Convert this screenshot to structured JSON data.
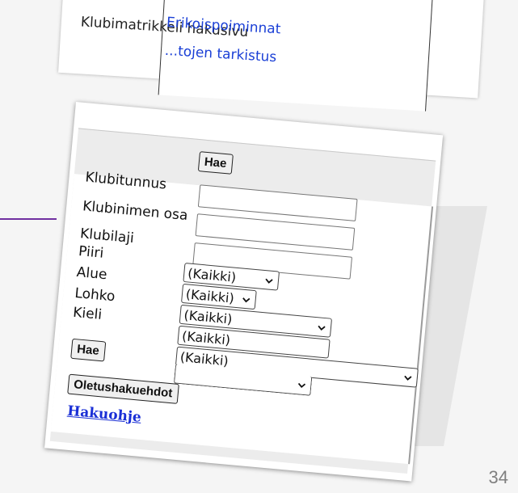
{
  "slide": {
    "number": "34"
  },
  "top_menu": {
    "partial_text": "Klubimatrikkeli hakusivu",
    "items": [
      "Erikoispoiminnat",
      "...tojen tarkistus"
    ]
  },
  "form": {
    "top_button": "Hae",
    "fields": [
      {
        "label": "Klubitunnus",
        "type": "text",
        "value": ""
      },
      {
        "label": "Klubinimen osa",
        "type": "text",
        "value": ""
      },
      {
        "label": "Klubilaji",
        "type": "select",
        "value": "(Kaikki)"
      },
      {
        "label": "Piiri",
        "type": "select",
        "value": "(Kaikki)"
      },
      {
        "label": "Alue",
        "type": "select",
        "value": "(Kaikki)"
      },
      {
        "label": "Lohko",
        "type": "select",
        "value": "(Kaikki)"
      },
      {
        "label": "Kieli",
        "type": "select",
        "value": "(Kaikki)"
      }
    ],
    "bottom_button": "Hae",
    "defaults_button": "Oletushakuehdot",
    "help_link": "Hakuohje"
  },
  "colors": {
    "accent": "#7030a0",
    "link": "#1a3fd6"
  }
}
